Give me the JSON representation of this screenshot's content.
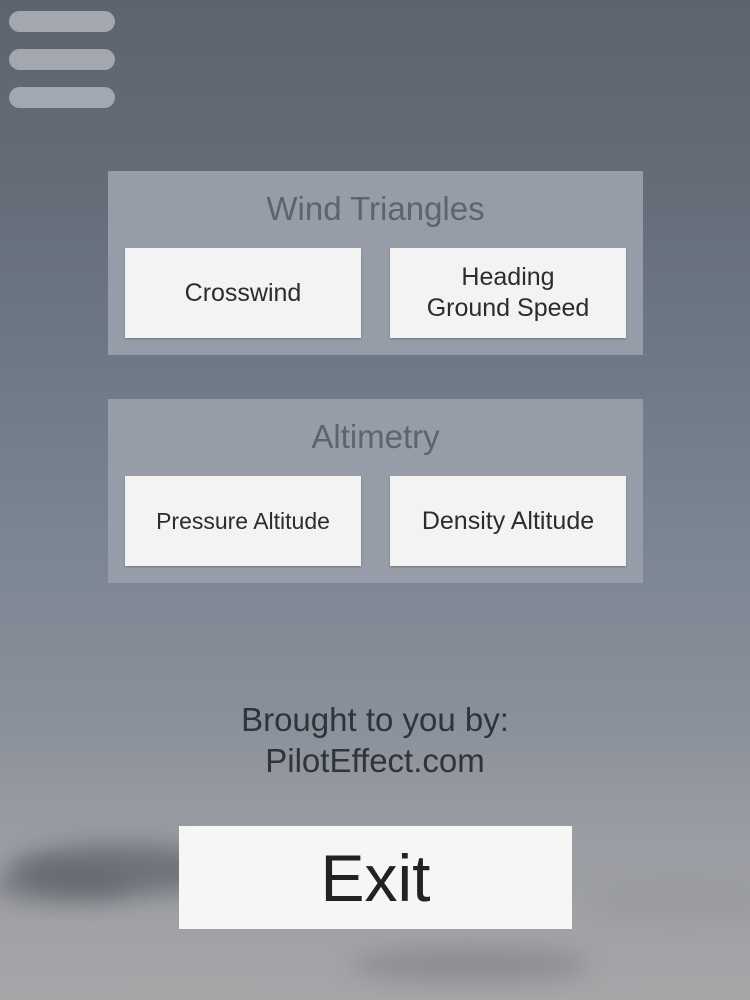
{
  "menu": {
    "icon": "hamburger-menu-icon"
  },
  "wind_triangles": {
    "title": "Wind Triangles",
    "crosswind_label": "Crosswind",
    "heading_label_line1": "Heading",
    "heading_label_line2": "Ground Speed"
  },
  "altimetry": {
    "title": "Altimetry",
    "pressure_label": "Pressure Altitude",
    "density_label": "Density Altitude"
  },
  "credit": {
    "line1": "Brought to you by:",
    "line2": "PilotEffect.com"
  },
  "exit": {
    "label": "Exit"
  }
}
